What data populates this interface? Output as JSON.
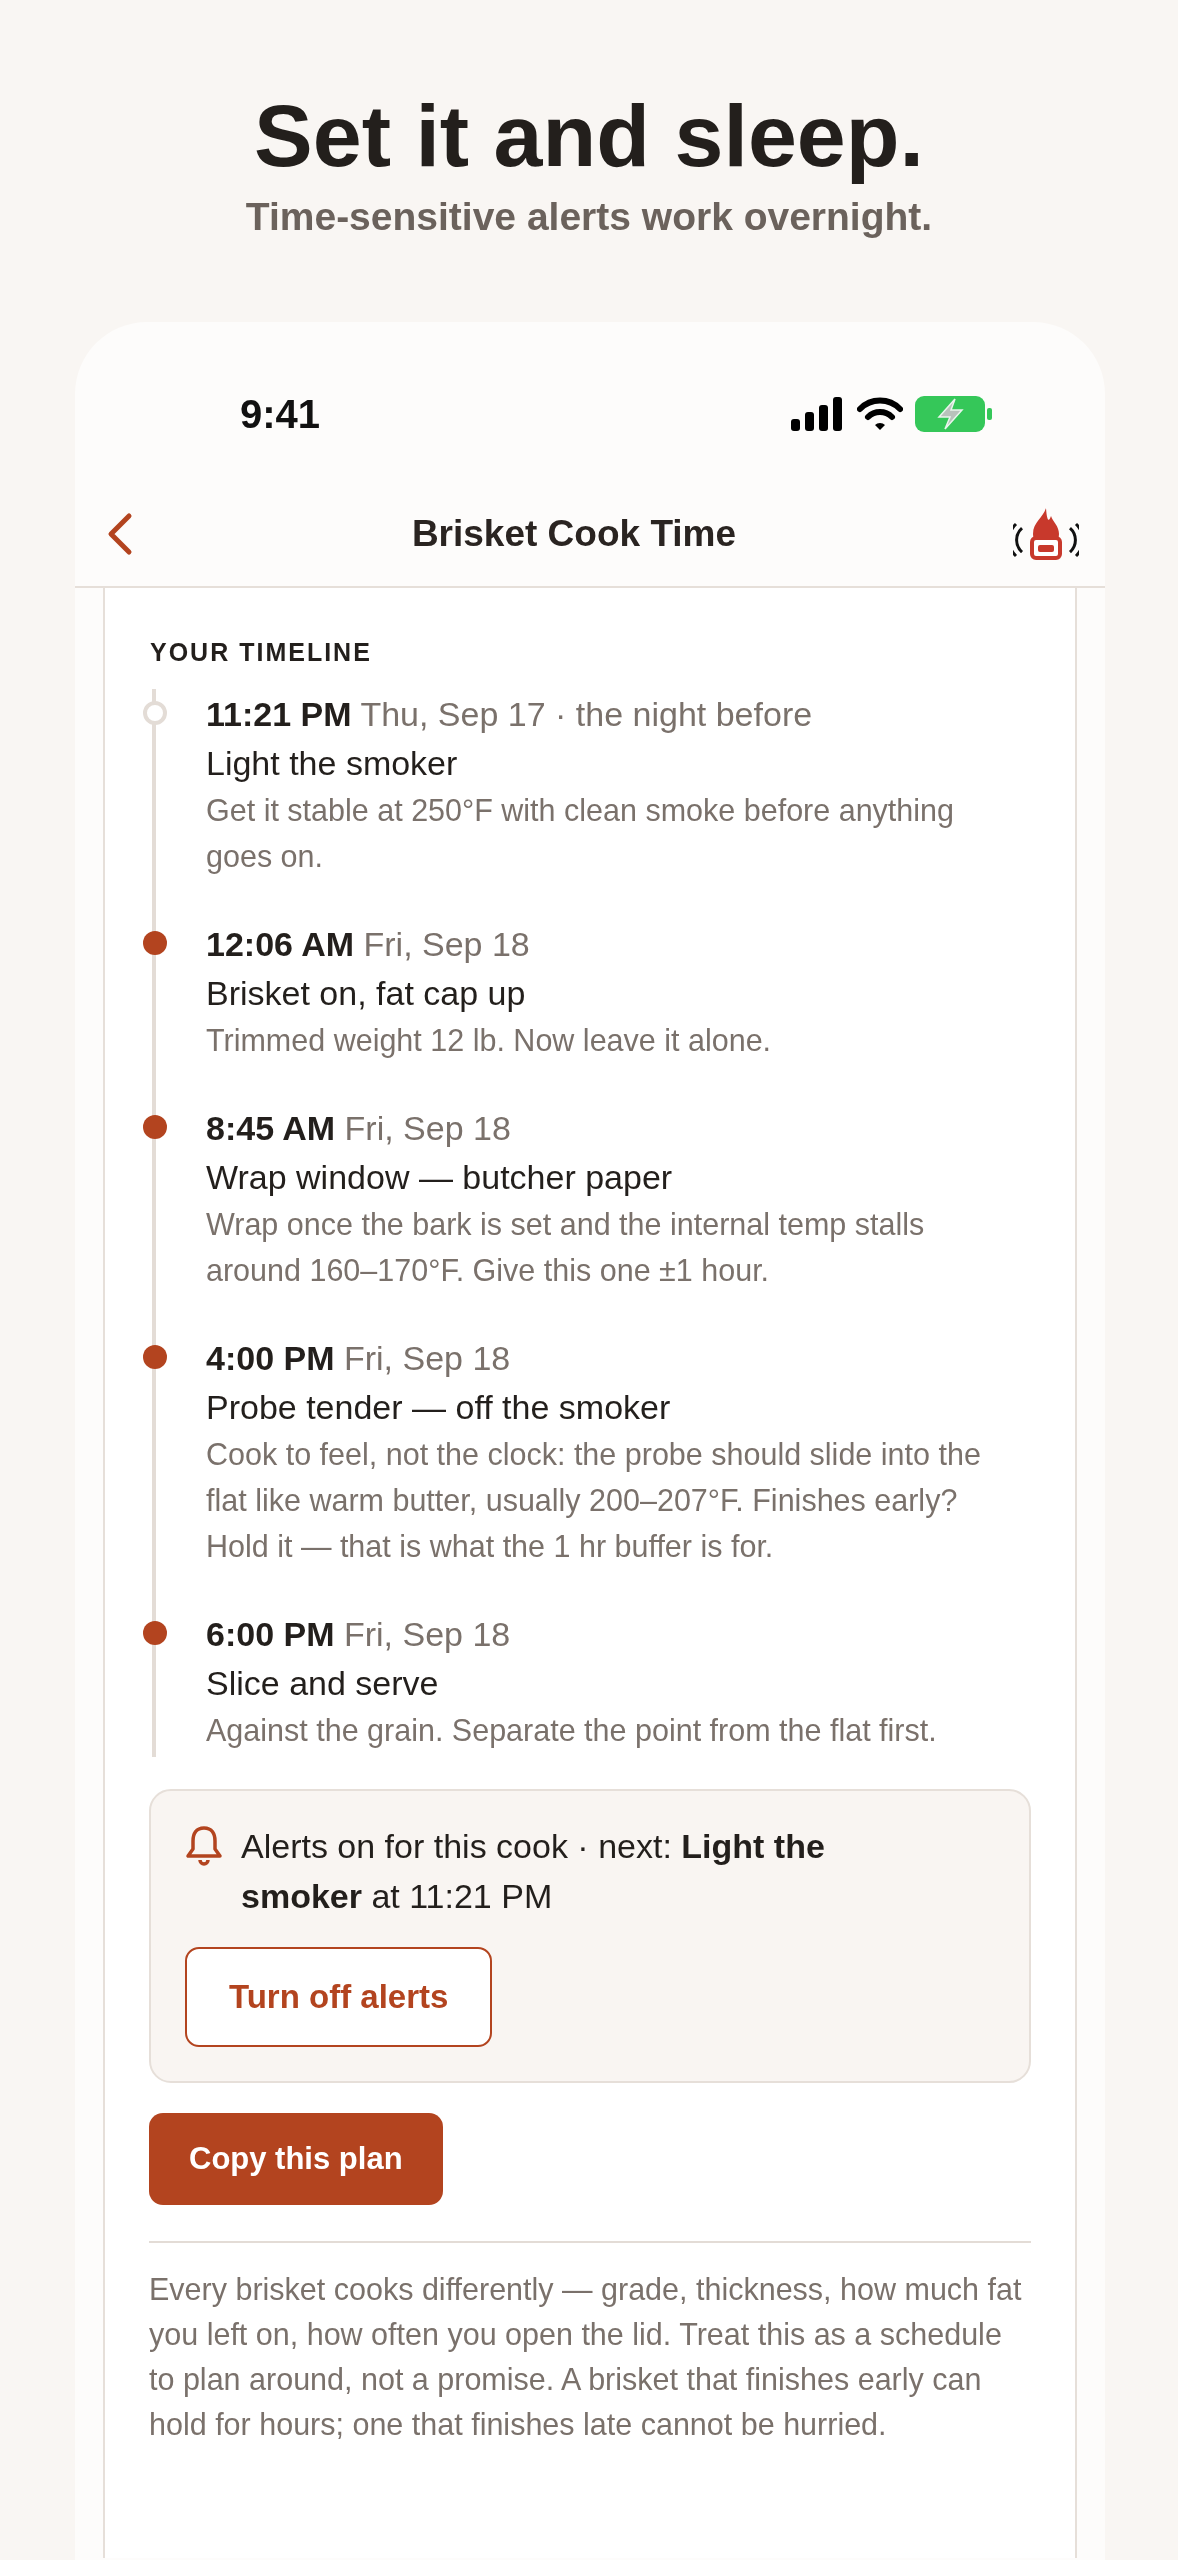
{
  "promo": {
    "headline": "Set it and sleep.",
    "subhead": "Time-sensitive alerts work overnight."
  },
  "status_bar": {
    "time": "9:41"
  },
  "nav": {
    "title": "Brisket Cook Time"
  },
  "timeline": {
    "heading": "YOUR TIMELINE",
    "items": [
      {
        "kind": "open",
        "time": "11:21 PM",
        "date": "Thu, Sep 17 · the night before",
        "title": "Light the smoker",
        "note": "Get it stable at 250°F with clean smoke before anything goes on."
      },
      {
        "kind": "filled",
        "time": "12:06 AM",
        "date": "Fri, Sep 18",
        "title": "Brisket on, fat cap up",
        "note": "Trimmed weight 12 lb. Now leave it alone."
      },
      {
        "kind": "filled",
        "time": "8:45 AM",
        "date": "Fri, Sep 18",
        "title": "Wrap window — butcher paper",
        "note": "Wrap once the bark is set and the internal temp stalls around 160–170°F. Give this one ±1 hour."
      },
      {
        "kind": "filled",
        "time": "4:00 PM",
        "date": "Fri, Sep 18",
        "title": "Probe tender — off the smoker",
        "note": "Cook to feel, not the clock: the probe should slide into the flat like warm butter, usually 200–207°F. Finishes early? Hold it — that is what the 1 hr buffer is for."
      },
      {
        "kind": "filled",
        "time": "6:00 PM",
        "date": "Fri, Sep 18",
        "title": "Slice and serve",
        "note": "Against the grain. Separate the point from the flat first."
      }
    ]
  },
  "alerts": {
    "message": "Alerts on for this cook · next: **Light the smoker** at 11:21 PM",
    "button": "Turn off alerts"
  },
  "copy_button": "Copy this plan",
  "disclaimer": "Every brisket cooks differently — grade, thickness, how much fat you left on, how often you open the lid. Treat this as a schedule to plan around, not a promise. A brisket that finishes early can hold for hours; one that finishes late cannot be hurried."
}
